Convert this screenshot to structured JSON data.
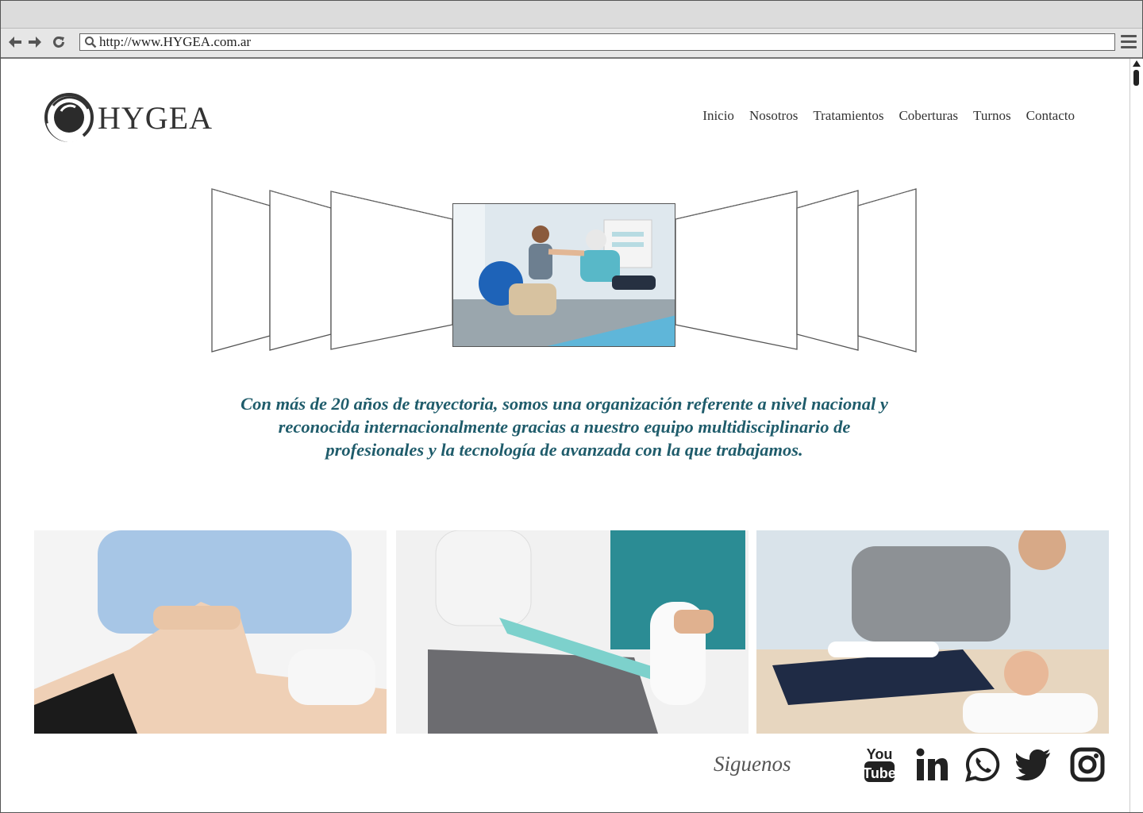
{
  "browser": {
    "url": "http://www.HYGEA.com.ar"
  },
  "site": {
    "logo_text": "HYGEA",
    "nav": [
      "Inicio",
      "Nosotros",
      "Tratamientos",
      "Coberturas",
      "Turnos",
      "Contacto"
    ],
    "tagline_lines": [
      "Con más de 20 años de trayectoria, somos una organización referente a nivel nacional y",
      "reconocida internacionalmente gracias a nuestro equipo multidisciplinario de",
      "profesionales y la tecnología de avanzada con la que trabajamos."
    ],
    "follow_label": "Siguenos",
    "social": [
      "youtube-icon",
      "linkedin-icon",
      "whatsapp-icon",
      "twitter-icon",
      "instagram-icon"
    ],
    "accent_color": "#1f5c6b"
  }
}
